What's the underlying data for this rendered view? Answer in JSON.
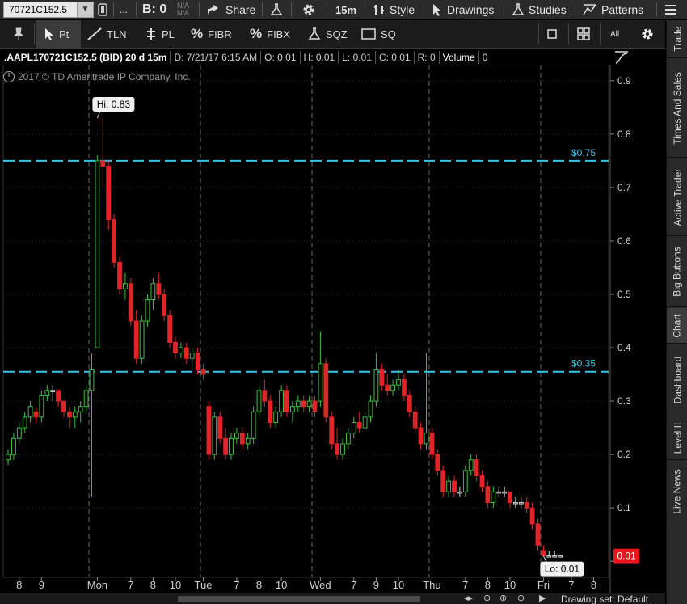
{
  "toolbar": {
    "symbol": "70721C152.5",
    "b_label": "B: 0",
    "na_top": "N/A",
    "na_bottom": "N/A",
    "share_label": "Share",
    "timeframe": "15m",
    "style_label": "Style",
    "drawings_label": "Drawings",
    "studies_label": "Studies",
    "patterns_label": "Patterns",
    "dots": "..."
  },
  "tools": {
    "pt": "Pt",
    "tln": "TLN",
    "pl": "PL",
    "fibr": "FIBR",
    "fibx": "FIBX",
    "sqz": "SQZ",
    "sq": "SQ",
    "all": "All"
  },
  "info": {
    "symbol": ".AAPL170721C152.5 (BID) 20 d 15m",
    "date": "D: 7/21/17 6:15 AM",
    "open": "O: 0.01",
    "high": "H: 0.01",
    "low": "L: 0.01",
    "close": "C: 0.01",
    "range": "R: 0",
    "volume_label": "Volume",
    "volume_value": "0"
  },
  "copyright": "2017 © TD Ameritrade IP Company, Inc.",
  "side_tabs": [
    "Trade",
    "Times And Sales",
    "Active Trader",
    "Big Buttons",
    "Chart",
    "Dashboard",
    "Level II",
    "Live News"
  ],
  "bottom": {
    "drawing_set": "Drawing set: Default"
  },
  "colors": {
    "up": "#3ec23e",
    "down": "#e0242a",
    "neutral": "#d8d8d8",
    "level_line": "#39c5e6",
    "last_price_bg": "#e8161b",
    "grid": "#2a2a2a"
  },
  "chart_data": {
    "type": "candlestick",
    "title": "",
    "xlabel": "",
    "ylabel": "",
    "ylim": [
      -0.03,
      0.93
    ],
    "y_ticks": [
      0.1,
      0.2,
      0.3,
      0.4,
      0.5,
      0.6,
      0.7,
      0.8,
      0.9
    ],
    "x_ticks": [
      {
        "label": "8",
        "i": 2
      },
      {
        "label": "9",
        "i": 6
      },
      {
        "label": "Mon",
        "i": 16
      },
      {
        "label": "7",
        "i": 22
      },
      {
        "label": "8",
        "i": 26
      },
      {
        "label": "10",
        "i": 30
      },
      {
        "label": "Tue",
        "i": 35
      },
      {
        "label": "7",
        "i": 41
      },
      {
        "label": "8",
        "i": 45
      },
      {
        "label": "10",
        "i": 49
      },
      {
        "label": "Wed",
        "i": 56
      },
      {
        "label": "7",
        "i": 62
      },
      {
        "label": "9",
        "i": 66
      },
      {
        "label": "10",
        "i": 70
      },
      {
        "label": "Thu",
        "i": 76
      },
      {
        "label": "7",
        "i": 82
      },
      {
        "label": "8",
        "i": 86
      },
      {
        "label": "10",
        "i": 90
      },
      {
        "label": "Fri",
        "i": 96
      },
      {
        "label": "7",
        "i": 101
      },
      {
        "label": "8",
        "i": 105
      }
    ],
    "day_separators": [
      15,
      35,
      55,
      76,
      96
    ],
    "levels": [
      {
        "label": "$0.75",
        "value": 0.75
      },
      {
        "label": "$0.35",
        "value": 0.355
      }
    ],
    "hi_label": "Hi: 0.83",
    "hi_value": 0.83,
    "hi_index": 16,
    "lo_label": "Lo: 0.01",
    "lo_value": 0.01,
    "lo_index": 96,
    "last_label": "0.01",
    "last_value": 0.01,
    "candles": [
      [
        0.19,
        0.21,
        0.18,
        0.2
      ],
      [
        0.2,
        0.24,
        0.19,
        0.23
      ],
      [
        0.23,
        0.26,
        0.22,
        0.25
      ],
      [
        0.25,
        0.28,
        0.24,
        0.27
      ],
      [
        0.27,
        0.3,
        0.26,
        0.29
      ],
      [
        0.28,
        0.29,
        0.26,
        0.27
      ],
      [
        0.27,
        0.32,
        0.26,
        0.31
      ],
      [
        0.31,
        0.33,
        0.3,
        0.32
      ],
      [
        0.32,
        0.33,
        0.3,
        0.32
      ],
      [
        0.32,
        0.32,
        0.29,
        0.3
      ],
      [
        0.3,
        0.3,
        0.27,
        0.28
      ],
      [
        0.28,
        0.29,
        0.25,
        0.27
      ],
      [
        0.27,
        0.29,
        0.25,
        0.28
      ],
      [
        0.28,
        0.3,
        0.26,
        0.29
      ],
      [
        0.29,
        0.33,
        0.28,
        0.32
      ],
      [
        0.32,
        0.39,
        0.12,
        0.36
      ],
      [
        0.4,
        0.76,
        0.4,
        0.75
      ],
      [
        0.75,
        0.83,
        0.7,
        0.74
      ],
      [
        0.74,
        0.75,
        0.62,
        0.64
      ],
      [
        0.64,
        0.65,
        0.55,
        0.56
      ],
      [
        0.56,
        0.57,
        0.5,
        0.51
      ],
      [
        0.51,
        0.54,
        0.49,
        0.52
      ],
      [
        0.52,
        0.53,
        0.44,
        0.45
      ],
      [
        0.45,
        0.47,
        0.37,
        0.38
      ],
      [
        0.38,
        0.46,
        0.37,
        0.45
      ],
      [
        0.45,
        0.5,
        0.44,
        0.49
      ],
      [
        0.49,
        0.53,
        0.47,
        0.52
      ],
      [
        0.52,
        0.54,
        0.49,
        0.5
      ],
      [
        0.5,
        0.51,
        0.45,
        0.46
      ],
      [
        0.46,
        0.47,
        0.4,
        0.41
      ],
      [
        0.41,
        0.42,
        0.38,
        0.39
      ],
      [
        0.39,
        0.41,
        0.38,
        0.4
      ],
      [
        0.4,
        0.41,
        0.37,
        0.38
      ],
      [
        0.38,
        0.4,
        0.36,
        0.39
      ],
      [
        0.39,
        0.4,
        0.35,
        0.36
      ],
      [
        0.36,
        0.37,
        0.34,
        0.35
      ],
      [
        0.29,
        0.3,
        0.19,
        0.2
      ],
      [
        0.2,
        0.28,
        0.19,
        0.27
      ],
      [
        0.27,
        0.28,
        0.22,
        0.23
      ],
      [
        0.23,
        0.25,
        0.19,
        0.2
      ],
      [
        0.2,
        0.24,
        0.19,
        0.23
      ],
      [
        0.23,
        0.25,
        0.22,
        0.24
      ],
      [
        0.24,
        0.25,
        0.21,
        0.22
      ],
      [
        0.22,
        0.24,
        0.21,
        0.23
      ],
      [
        0.23,
        0.29,
        0.22,
        0.28
      ],
      [
        0.28,
        0.33,
        0.27,
        0.32
      ],
      [
        0.32,
        0.34,
        0.29,
        0.3
      ],
      [
        0.3,
        0.31,
        0.25,
        0.26
      ],
      [
        0.26,
        0.29,
        0.25,
        0.28
      ],
      [
        0.28,
        0.33,
        0.27,
        0.32
      ],
      [
        0.32,
        0.33,
        0.27,
        0.28
      ],
      [
        0.28,
        0.3,
        0.26,
        0.29
      ],
      [
        0.29,
        0.31,
        0.28,
        0.3
      ],
      [
        0.3,
        0.31,
        0.28,
        0.29
      ],
      [
        0.29,
        0.31,
        0.28,
        0.3
      ],
      [
        0.3,
        0.31,
        0.27,
        0.28
      ],
      [
        0.3,
        0.43,
        0.29,
        0.37
      ],
      [
        0.37,
        0.38,
        0.26,
        0.27
      ],
      [
        0.27,
        0.28,
        0.21,
        0.22
      ],
      [
        0.22,
        0.25,
        0.19,
        0.2
      ],
      [
        0.2,
        0.23,
        0.19,
        0.22
      ],
      [
        0.22,
        0.25,
        0.21,
        0.24
      ],
      [
        0.24,
        0.27,
        0.23,
        0.26
      ],
      [
        0.26,
        0.28,
        0.24,
        0.25
      ],
      [
        0.25,
        0.28,
        0.24,
        0.27
      ],
      [
        0.27,
        0.31,
        0.26,
        0.3
      ],
      [
        0.3,
        0.39,
        0.29,
        0.36
      ],
      [
        0.36,
        0.37,
        0.32,
        0.33
      ],
      [
        0.33,
        0.35,
        0.31,
        0.32
      ],
      [
        0.32,
        0.34,
        0.31,
        0.33
      ],
      [
        0.33,
        0.36,
        0.32,
        0.34
      ],
      [
        0.34,
        0.35,
        0.3,
        0.31
      ],
      [
        0.31,
        0.32,
        0.27,
        0.28
      ],
      [
        0.28,
        0.29,
        0.24,
        0.25
      ],
      [
        0.25,
        0.26,
        0.21,
        0.22
      ],
      [
        0.22,
        0.39,
        0.21,
        0.24
      ],
      [
        0.24,
        0.25,
        0.19,
        0.2
      ],
      [
        0.2,
        0.21,
        0.16,
        0.17
      ],
      [
        0.17,
        0.18,
        0.12,
        0.13
      ],
      [
        0.13,
        0.16,
        0.12,
        0.15
      ],
      [
        0.15,
        0.16,
        0.12,
        0.13
      ],
      [
        0.13,
        0.14,
        0.12,
        0.13
      ],
      [
        0.13,
        0.18,
        0.12,
        0.17
      ],
      [
        0.17,
        0.2,
        0.16,
        0.19
      ],
      [
        0.19,
        0.2,
        0.15,
        0.16
      ],
      [
        0.16,
        0.17,
        0.13,
        0.14
      ],
      [
        0.14,
        0.15,
        0.1,
        0.11
      ],
      [
        0.11,
        0.14,
        0.1,
        0.13
      ],
      [
        0.13,
        0.14,
        0.12,
        0.13
      ],
      [
        0.13,
        0.14,
        0.12,
        0.13
      ],
      [
        0.13,
        0.13,
        0.1,
        0.11
      ],
      [
        0.11,
        0.12,
        0.1,
        0.11
      ],
      [
        0.11,
        0.12,
        0.1,
        0.11
      ],
      [
        0.11,
        0.12,
        0.09,
        0.1
      ],
      [
        0.1,
        0.11,
        0.06,
        0.07
      ],
      [
        0.07,
        0.08,
        0.02,
        0.03
      ],
      [
        0.02,
        0.03,
        0.01,
        0.01
      ],
      [
        0.01,
        0.02,
        0.01,
        0.01
      ],
      [
        0.01,
        0.02,
        0.01,
        0.01
      ],
      [
        0.01,
        0.01,
        0.01,
        0.01
      ]
    ]
  }
}
